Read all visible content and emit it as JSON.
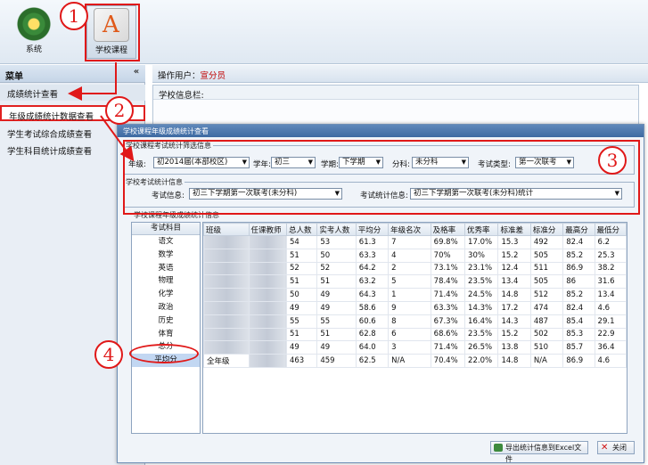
{
  "toolbar": {
    "system_label": "系统",
    "school_course_label": "学校课程"
  },
  "menu": {
    "title": "菜单",
    "collapse_glyph": "«",
    "items": [
      {
        "label": "成绩统计查看"
      },
      {
        "label": "年级成绩统计数据查看"
      },
      {
        "label": "学生考试综合成绩查看"
      },
      {
        "label": "学生科目统计成绩查看"
      }
    ]
  },
  "main": {
    "operator_label": "操作用户：",
    "operator_name": "宣分员",
    "school_info_label": "学校信息栏:"
  },
  "dialog": {
    "title": "学校课程年级成绩统计查看",
    "filter_legend": "学校课程考试统计筛选信息",
    "grade_label": "年级:",
    "grade_value": "初2014届(本部校区)",
    "year_label": "学年:",
    "year_value": "初三",
    "term_label": "学期:",
    "term_value": "下学期",
    "subject_label": "分科:",
    "subject_value": "未分科",
    "exam_type_label": "考试类型:",
    "exam_type_value": "第一次联考",
    "exam_legend": "学校考试统计信息",
    "exam_info_label": "考试信息:",
    "exam_info_value": "初三下学期第一次联考(未分科)",
    "stat_info_label": "考试统计信息:",
    "stat_info_value": "初三下学期第一次联考(未分科)统计",
    "grid_legend": "学校课程年级成绩统计信息",
    "subject_column": "考试科目",
    "subjects": [
      "语文",
      "数学",
      "英语",
      "物理",
      "化学",
      "政治",
      "历史",
      "体育",
      "总分",
      "平均分"
    ],
    "columns": [
      "班级",
      "任课教师",
      "总人数",
      "实考人数",
      "平均分",
      "年级名次",
      "及格率",
      "优秀率",
      "标准差",
      "标准分",
      "最高分",
      "最低分"
    ],
    "rows": [
      [
        "",
        "",
        "54",
        "53",
        "61.3",
        "7",
        "69.8%",
        "17.0%",
        "15.3",
        "492",
        "82.4",
        "6.2"
      ],
      [
        "",
        "",
        "51",
        "50",
        "63.3",
        "4",
        "70%",
        "30%",
        "15.2",
        "505",
        "85.2",
        "25.3"
      ],
      [
        "",
        "",
        "52",
        "52",
        "64.2",
        "2",
        "73.1%",
        "23.1%",
        "12.4",
        "511",
        "86.9",
        "38.2"
      ],
      [
        "",
        "",
        "51",
        "51",
        "63.2",
        "5",
        "78.4%",
        "23.5%",
        "13.4",
        "505",
        "86",
        "31.6"
      ],
      [
        "",
        "",
        "50",
        "49",
        "64.3",
        "1",
        "71.4%",
        "24.5%",
        "14.8",
        "512",
        "85.2",
        "13.4"
      ],
      [
        "",
        "",
        "49",
        "49",
        "58.6",
        "9",
        "63.3%",
        "14.3%",
        "17.2",
        "474",
        "82.4",
        "4.6"
      ],
      [
        "",
        "",
        "55",
        "55",
        "60.6",
        "8",
        "67.3%",
        "16.4%",
        "14.3",
        "487",
        "85.4",
        "29.1"
      ],
      [
        "",
        "",
        "51",
        "51",
        "62.8",
        "6",
        "68.6%",
        "23.5%",
        "15.2",
        "502",
        "85.3",
        "22.9"
      ],
      [
        "",
        "",
        "49",
        "49",
        "64.0",
        "3",
        "71.4%",
        "26.5%",
        "13.8",
        "510",
        "85.7",
        "36.4"
      ],
      [
        "全年级",
        "",
        "463",
        "459",
        "62.5",
        "N/A",
        "70.4%",
        "22.0%",
        "14.8",
        "N/A",
        "86.9",
        "4.6"
      ]
    ],
    "export_button": "导出统计信息到Excel文件",
    "close_button": "关闭"
  },
  "annotations": [
    "1",
    "2",
    "3",
    "4"
  ],
  "colors": {
    "annotation_red": "#e01818",
    "title_bar": "#3d6aa2",
    "operator_red": "#c00000"
  }
}
